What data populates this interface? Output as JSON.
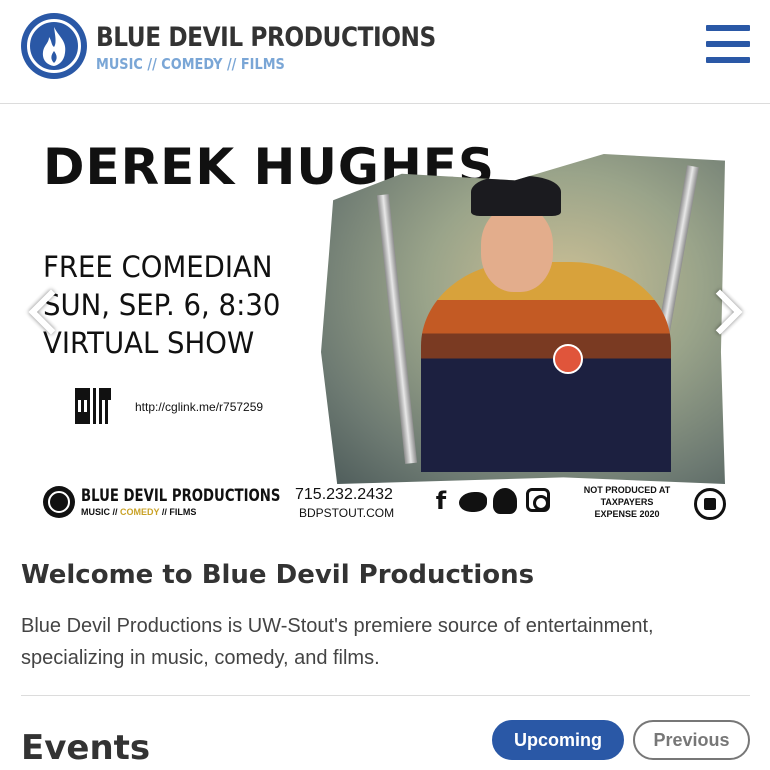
{
  "header": {
    "brand_title": "BLUE DEVIL PRODUCTIONS",
    "brand_subtitle": "MUSIC // COMEDY // FILMS",
    "menu_icon": "hamburger-menu-icon",
    "accent_color": "#2a58a6",
    "subtitle_color": "#7aa6d6"
  },
  "banner": {
    "headline": "DEREK HUGHES",
    "lines": [
      "FREE COMEDIAN",
      "SUN, SEP. 6, 8:30",
      "VIRTUAL SHOW"
    ],
    "qr_url": "http://cglink.me/r757259",
    "footer_brand": "BLUE DEVIL PRODUCTIONS",
    "footer_sub": {
      "music": "MUSIC",
      "sep1": " // ",
      "comedy": "COMEDY",
      "sep2": " // ",
      "films": "FILMS"
    },
    "phone": "715.232.2432",
    "website": "BDPSTOUT.COM",
    "social_icons": [
      "facebook-icon",
      "twitter-icon",
      "snapchat-icon",
      "instagram-icon"
    ],
    "facebook_glyph": "f",
    "note": "NOT PRODUCED AT TAXPAYERS EXPENSE 2020",
    "prev_icon": "chevron-left-icon",
    "next_icon": "chevron-right-icon"
  },
  "welcome": {
    "title": "Welcome to Blue Devil Productions",
    "text": "Blue Devil Productions is UW-Stout's premiere source of entertainment, specializing in music, comedy, and films."
  },
  "events": {
    "title": "Events",
    "upcoming_label": "Upcoming",
    "previous_label": "Previous"
  }
}
